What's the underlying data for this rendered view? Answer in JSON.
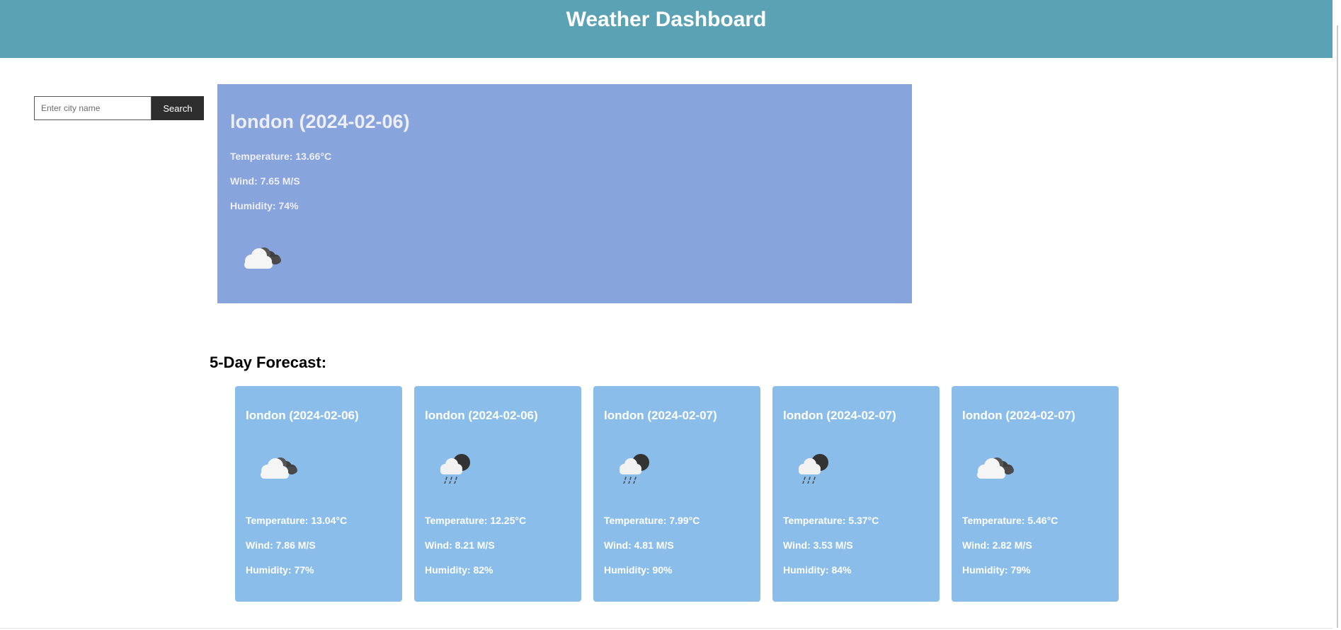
{
  "header": {
    "title": "Weather Dashboard"
  },
  "search": {
    "placeholder": "Enter city name",
    "value": "",
    "button_label": "Search"
  },
  "current": {
    "city": "london (2024-02-06)",
    "temperature": "Temperature: 13.66°C",
    "wind": "Wind: 7.65 M/S",
    "humidity": "Humidity: 74%",
    "icon": "cloudy-icon"
  },
  "forecast": {
    "title": "5-Day Forecast:",
    "days": [
      {
        "city": "london (2024-02-06)",
        "icon": "cloudy-icon",
        "temperature": "Temperature: 13.04°C",
        "wind": "Wind: 7.86 M/S",
        "humidity": "Humidity: 77%"
      },
      {
        "city": "london (2024-02-06)",
        "icon": "rain-icon",
        "temperature": "Temperature: 12.25°C",
        "wind": "Wind: 8.21 M/S",
        "humidity": "Humidity: 82%"
      },
      {
        "city": "london (2024-02-07)",
        "icon": "rain-icon",
        "temperature": "Temperature: 7.99°C",
        "wind": "Wind: 4.81 M/S",
        "humidity": "Humidity: 90%"
      },
      {
        "city": "london (2024-02-07)",
        "icon": "rain-icon",
        "temperature": "Temperature: 5.37°C",
        "wind": "Wind: 3.53 M/S",
        "humidity": "Humidity: 84%"
      },
      {
        "city": "london (2024-02-07)",
        "icon": "cloudy-icon",
        "temperature": "Temperature: 5.46°C",
        "wind": "Wind: 2.82 M/S",
        "humidity": "Humidity: 79%"
      }
    ]
  },
  "colors": {
    "header": "#5ba2b5",
    "current_card": "#88a4dc",
    "forecast_card": "#8bbdea",
    "search_button": "#2d2d2d"
  }
}
